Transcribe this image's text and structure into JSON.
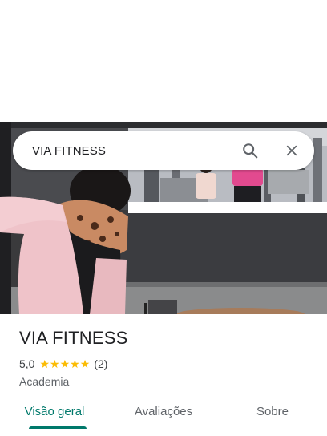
{
  "search": {
    "query": "VIA FITNESS"
  },
  "icons": {
    "search": "search-icon",
    "close": "close-icon",
    "star": "star-icon"
  },
  "place": {
    "title": "VIA FITNESS",
    "rating": "5,0",
    "stars": 5,
    "review_count": "(2)",
    "category": "Academia"
  },
  "tabs": [
    {
      "label": "Visão geral",
      "active": true
    },
    {
      "label": "Avaliações",
      "active": false
    },
    {
      "label": "Sobre",
      "active": false
    }
  ],
  "colors": {
    "accent": "#00796b",
    "star": "#fbbc04",
    "title_text": "#202124",
    "secondary_text": "#5f6368"
  }
}
